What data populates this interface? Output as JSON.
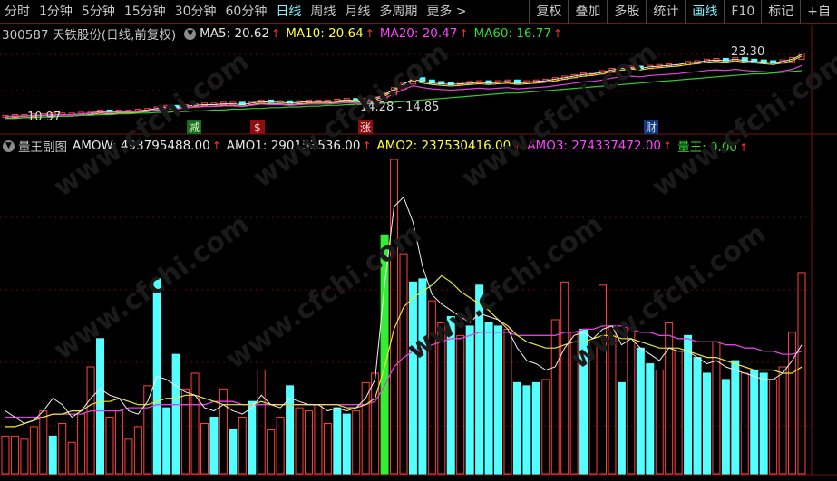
{
  "toolbar": {
    "periods": [
      "分时",
      "1分钟",
      "5分钟",
      "15分钟",
      "30分钟",
      "60分钟",
      "日线",
      "周线",
      "月线",
      "多周期",
      "更多 >"
    ],
    "active_period": "日线",
    "actions": [
      "复权",
      "叠加",
      "多股",
      "统计",
      "画线",
      "F10",
      "标记",
      "+自"
    ],
    "active_action": "画线"
  },
  "main_panel": {
    "title": "300587 天铁股份(日线,前复权)",
    "indicators": [
      {
        "label": "MA5: 20.62",
        "color": "#e8e8e8"
      },
      {
        "label": "MA10: 20.64",
        "color": "#ffff3a"
      },
      {
        "label": "MA20: 20.47",
        "color": "#ff44ff"
      },
      {
        "label": "MA60: 16.77",
        "color": "#33dd33"
      }
    ],
    "annotations": {
      "high_label": "23.30",
      "range_label": "14.28 - 14.85",
      "low_label": "10.97"
    },
    "event_markers": [
      {
        "text": "减",
        "bg": "#1c6a1c",
        "color": "#d0ffd0"
      },
      {
        "text": "$",
        "bg": "#8a1010",
        "color": "#ffd0d0"
      },
      {
        "text": "涨",
        "bg": "#8a1010",
        "color": "#ffe0e0"
      },
      {
        "text": "财",
        "bg": "#123a7a",
        "color": "#d0e0ff"
      }
    ]
  },
  "sub_panel": {
    "title": "量王副图",
    "indicators": [
      {
        "label": "AMOW: 493795488.00",
        "color": "#e8e8e8"
      },
      {
        "label": "AMO1: 290153536.00",
        "color": "#e8e8e8"
      },
      {
        "label": "AMO2: 237530416.00",
        "color": "#ffff3a"
      },
      {
        "label": "AMO3: 274337472.00",
        "color": "#ff44ff"
      },
      {
        "label": "量王: 0.00",
        "color": "#33dd33"
      }
    ]
  },
  "watermark": "www.cfchi.com",
  "colors": {
    "up": "#ff4040",
    "down": "#54ffff",
    "signal": "#33ee33",
    "amo1": "#f0f0f0",
    "amo2": "#e8e830",
    "amo3": "#dd44dd",
    "ma5": "#e8e8e8",
    "ma10": "#e8e830",
    "ma20": "#dd44dd",
    "ma60": "#33cc33"
  },
  "chart_data": {
    "type": "bar",
    "y_scale": "relative",
    "bars": [
      {
        "v": 0.12,
        "up": 1
      },
      {
        "v": 0.12,
        "up": 1
      },
      {
        "v": 0.11,
        "up": 1
      },
      {
        "v": 0.15,
        "up": 1
      },
      {
        "v": 0.2,
        "up": 1
      },
      {
        "v": 0.12,
        "up": 0
      },
      {
        "v": 0.16,
        "up": 1
      },
      {
        "v": 0.1,
        "up": 1
      },
      {
        "v": 0.19,
        "up": 1
      },
      {
        "v": 0.34,
        "up": 1
      },
      {
        "v": 0.43,
        "up": 0
      },
      {
        "v": 0.18,
        "up": 1
      },
      {
        "v": 0.2,
        "up": 1
      },
      {
        "v": 0.11,
        "up": 1
      },
      {
        "v": 0.15,
        "up": 1
      },
      {
        "v": 0.28,
        "up": 1
      },
      {
        "v": 0.62,
        "up": 0
      },
      {
        "v": 0.21,
        "up": 0
      },
      {
        "v": 0.38,
        "up": 0
      },
      {
        "v": 0.27,
        "up": 1
      },
      {
        "v": 0.32,
        "up": 1
      },
      {
        "v": 0.16,
        "up": 1
      },
      {
        "v": 0.18,
        "up": 0
      },
      {
        "v": 0.27,
        "up": 1
      },
      {
        "v": 0.14,
        "up": 0
      },
      {
        "v": 0.18,
        "up": 1
      },
      {
        "v": 0.23,
        "up": 0
      },
      {
        "v": 0.33,
        "up": 1
      },
      {
        "v": 0.14,
        "up": 1
      },
      {
        "v": 0.18,
        "up": 1
      },
      {
        "v": 0.28,
        "up": 0
      },
      {
        "v": 0.21,
        "up": 1
      },
      {
        "v": 0.2,
        "up": 1
      },
      {
        "v": 0.22,
        "up": 1
      },
      {
        "v": 0.16,
        "up": 1
      },
      {
        "v": 0.21,
        "up": 0
      },
      {
        "v": 0.19,
        "up": 0
      },
      {
        "v": 0.2,
        "up": 1
      },
      {
        "v": 0.29,
        "up": 1
      },
      {
        "v": 0.32,
        "up": 1
      },
      {
        "v": 0.76,
        "up": 2
      },
      {
        "v": 1.0,
        "up": 1
      },
      {
        "v": 0.7,
        "up": 1
      },
      {
        "v": 0.61,
        "up": 0
      },
      {
        "v": 0.62,
        "up": 0
      },
      {
        "v": 0.55,
        "up": 1
      },
      {
        "v": 0.48,
        "up": 1
      },
      {
        "v": 0.5,
        "up": 0
      },
      {
        "v": 0.44,
        "up": 1
      },
      {
        "v": 0.47,
        "up": 0
      },
      {
        "v": 0.6,
        "up": 0
      },
      {
        "v": 0.48,
        "up": 0
      },
      {
        "v": 0.47,
        "up": 0
      },
      {
        "v": 0.46,
        "up": 1
      },
      {
        "v": 0.29,
        "up": 0
      },
      {
        "v": 0.28,
        "up": 0
      },
      {
        "v": 0.29,
        "up": 0
      },
      {
        "v": 0.3,
        "up": 1
      },
      {
        "v": 0.49,
        "up": 1
      },
      {
        "v": 0.61,
        "up": 1
      },
      {
        "v": 0.45,
        "up": 1
      },
      {
        "v": 0.46,
        "up": 0
      },
      {
        "v": 0.42,
        "up": 1
      },
      {
        "v": 0.6,
        "up": 1
      },
      {
        "v": 0.47,
        "up": 1
      },
      {
        "v": 0.29,
        "up": 0
      },
      {
        "v": 0.46,
        "up": 1
      },
      {
        "v": 0.4,
        "up": 0
      },
      {
        "v": 0.35,
        "up": 0
      },
      {
        "v": 0.33,
        "up": 1
      },
      {
        "v": 0.48,
        "up": 1
      },
      {
        "v": 0.39,
        "up": 1
      },
      {
        "v": 0.44,
        "up": 0
      },
      {
        "v": 0.37,
        "up": 0
      },
      {
        "v": 0.32,
        "up": 0
      },
      {
        "v": 0.42,
        "up": 1
      },
      {
        "v": 0.3,
        "up": 0
      },
      {
        "v": 0.36,
        "up": 0
      },
      {
        "v": 0.32,
        "up": 1
      },
      {
        "v": 0.33,
        "up": 0
      },
      {
        "v": 0.32,
        "up": 0
      },
      {
        "v": 0.3,
        "up": 1
      },
      {
        "v": 0.34,
        "up": 1
      },
      {
        "v": 0.45,
        "up": 1
      },
      {
        "v": 0.64,
        "up": 1
      }
    ],
    "amo1": [
      0.2,
      0.18,
      0.16,
      0.17,
      0.2,
      0.24,
      0.22,
      0.18,
      0.2,
      0.24,
      0.27,
      0.25,
      0.24,
      0.2,
      0.19,
      0.23,
      0.31,
      0.3,
      0.28,
      0.26,
      0.25,
      0.21,
      0.2,
      0.22,
      0.2,
      0.19,
      0.21,
      0.25,
      0.22,
      0.21,
      0.24,
      0.23,
      0.22,
      0.22,
      0.2,
      0.21,
      0.2,
      0.21,
      0.24,
      0.3,
      0.6,
      0.85,
      0.88,
      0.8,
      0.66,
      0.57,
      0.54,
      0.52,
      0.5,
      0.48,
      0.51,
      0.5,
      0.49,
      0.46,
      0.4,
      0.36,
      0.35,
      0.33,
      0.34,
      0.4,
      0.44,
      0.45,
      0.43,
      0.46,
      0.47,
      0.41,
      0.43,
      0.4,
      0.38,
      0.36,
      0.4,
      0.39,
      0.39,
      0.37,
      0.35,
      0.36,
      0.34,
      0.33,
      0.32,
      0.31,
      0.3,
      0.3,
      0.32,
      0.36,
      0.41
    ],
    "amo2": [
      0.15,
      0.15,
      0.16,
      0.17,
      0.18,
      0.19,
      0.19,
      0.2,
      0.2,
      0.22,
      0.23,
      0.23,
      0.24,
      0.23,
      0.22,
      0.22,
      0.23,
      0.24,
      0.24,
      0.25,
      0.25,
      0.24,
      0.23,
      0.22,
      0.22,
      0.22,
      0.22,
      0.23,
      0.22,
      0.22,
      0.22,
      0.22,
      0.22,
      0.22,
      0.22,
      0.22,
      0.21,
      0.21,
      0.22,
      0.24,
      0.34,
      0.46,
      0.53,
      0.56,
      0.58,
      0.6,
      0.63,
      0.61,
      0.58,
      0.56,
      0.54,
      0.52,
      0.49,
      0.47,
      0.44,
      0.42,
      0.41,
      0.4,
      0.4,
      0.41,
      0.42,
      0.42,
      0.43,
      0.44,
      0.44,
      0.43,
      0.43,
      0.42,
      0.41,
      0.4,
      0.4,
      0.4,
      0.39,
      0.38,
      0.37,
      0.37,
      0.36,
      0.35,
      0.34,
      0.33,
      0.33,
      0.33,
      0.32,
      0.32,
      0.34
    ],
    "amo3": [
      0.18,
      0.18,
      0.18,
      0.18,
      0.18,
      0.19,
      0.19,
      0.19,
      0.19,
      0.2,
      0.2,
      0.2,
      0.2,
      0.21,
      0.21,
      0.21,
      0.22,
      0.22,
      0.22,
      0.22,
      0.22,
      0.22,
      0.23,
      0.23,
      0.23,
      0.22,
      0.22,
      0.22,
      0.22,
      0.22,
      0.22,
      0.22,
      0.22,
      0.22,
      0.22,
      0.22,
      0.22,
      0.22,
      0.22,
      0.23,
      0.28,
      0.34,
      0.37,
      0.39,
      0.4,
      0.41,
      0.42,
      0.43,
      0.43,
      0.44,
      0.45,
      0.45,
      0.45,
      0.45,
      0.44,
      0.44,
      0.44,
      0.44,
      0.44,
      0.45,
      0.45,
      0.46,
      0.46,
      0.47,
      0.47,
      0.47,
      0.46,
      0.45,
      0.45,
      0.44,
      0.44,
      0.43,
      0.43,
      0.42,
      0.42,
      0.42,
      0.41,
      0.41,
      0.4,
      0.4,
      0.39,
      0.39,
      0.38,
      0.38,
      0.39
    ],
    "price": [
      0.09,
      0.1,
      0.1,
      0.11,
      0.11,
      0.12,
      0.12,
      0.12,
      0.13,
      0.14,
      0.16,
      0.15,
      0.16,
      0.16,
      0.17,
      0.18,
      0.2,
      0.22,
      0.21,
      0.23,
      0.24,
      0.25,
      0.25,
      0.26,
      0.26,
      0.25,
      0.27,
      0.29,
      0.28,
      0.28,
      0.27,
      0.28,
      0.29,
      0.29,
      0.29,
      0.3,
      0.31,
      0.3,
      0.31,
      0.33,
      0.38,
      0.45,
      0.52,
      0.58,
      0.55,
      0.53,
      0.52,
      0.51,
      0.52,
      0.53,
      0.54,
      0.53,
      0.54,
      0.55,
      0.53,
      0.54,
      0.55,
      0.56,
      0.58,
      0.6,
      0.62,
      0.64,
      0.65,
      0.67,
      0.7,
      0.72,
      0.73,
      0.72,
      0.74,
      0.75,
      0.76,
      0.77,
      0.79,
      0.8,
      0.82,
      0.83,
      0.82,
      0.84,
      0.82,
      0.81,
      0.8,
      0.79,
      0.81,
      0.84,
      0.9
    ],
    "ma60": [
      0.05,
      0.05,
      0.06,
      0.06,
      0.07,
      0.07,
      0.08,
      0.08,
      0.09,
      0.09,
      0.1,
      0.1,
      0.11,
      0.11,
      0.12,
      0.12,
      0.13,
      0.13,
      0.14,
      0.14,
      0.15,
      0.15,
      0.16,
      0.16,
      0.17,
      0.17,
      0.18,
      0.18,
      0.19,
      0.19,
      0.2,
      0.2,
      0.21,
      0.21,
      0.22,
      0.22,
      0.23,
      0.23,
      0.24,
      0.24,
      0.25,
      0.26,
      0.27,
      0.28,
      0.29,
      0.3,
      0.31,
      0.32,
      0.33,
      0.34,
      0.35,
      0.36,
      0.37,
      0.38,
      0.38,
      0.39,
      0.4,
      0.41,
      0.42,
      0.43,
      0.44,
      0.45,
      0.46,
      0.47,
      0.48,
      0.49,
      0.5,
      0.51,
      0.52,
      0.53,
      0.54,
      0.55,
      0.56,
      0.57,
      0.58,
      0.59,
      0.6,
      0.61,
      0.62,
      0.63,
      0.63,
      0.64,
      0.65,
      0.66,
      0.67
    ]
  }
}
